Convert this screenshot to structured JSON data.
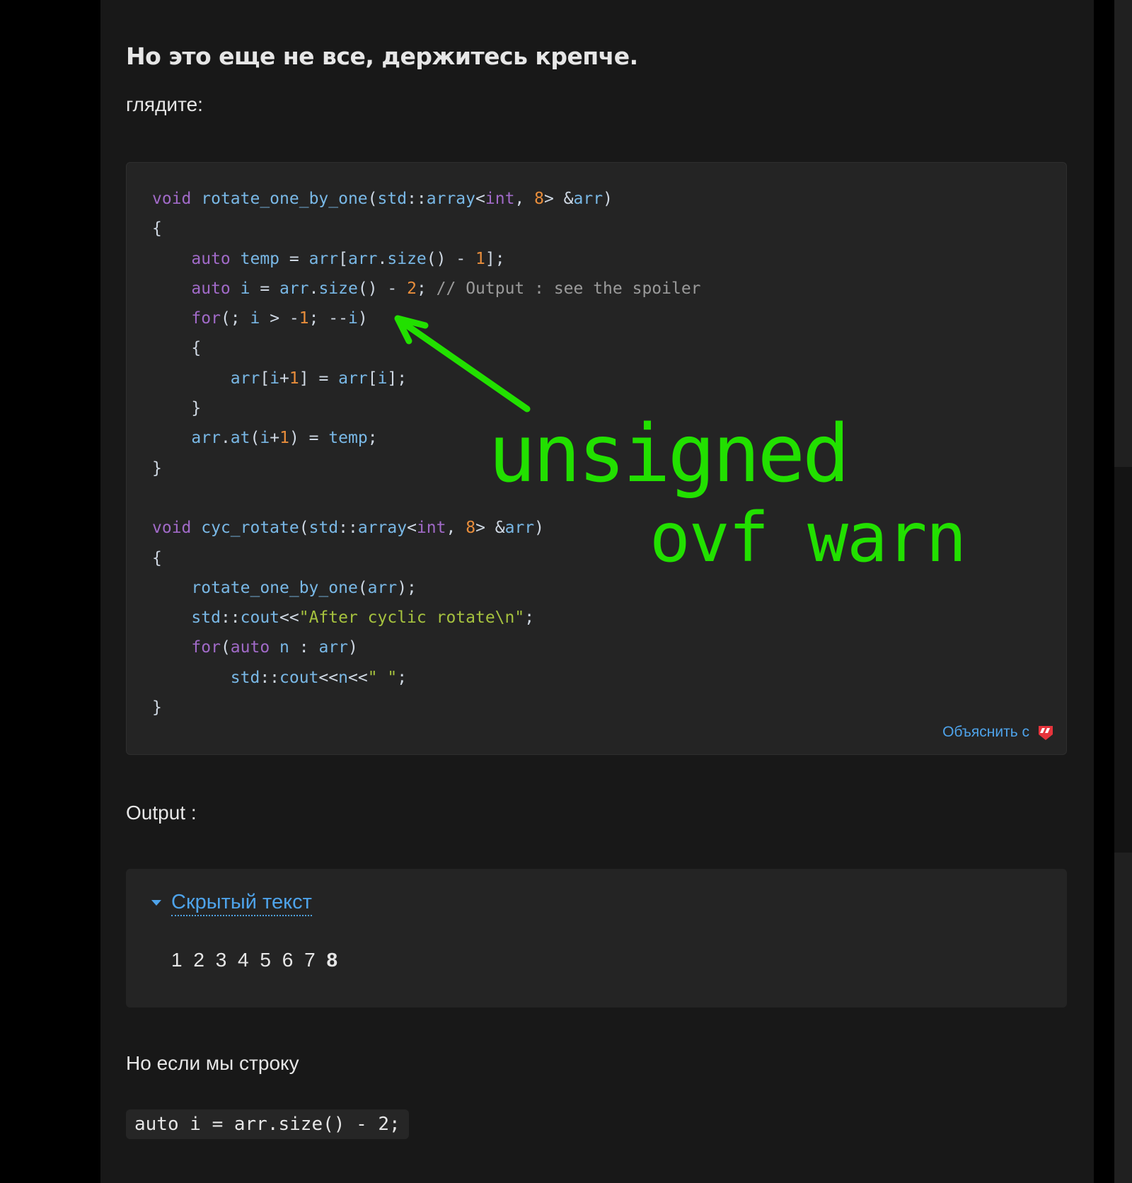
{
  "article": {
    "heading": "Но это еще не все, держитесь крепче.",
    "intro": "глядите:",
    "output_label": "Output :",
    "next_para": "Но если мы строку",
    "inline_code": "auto i = arr.size() - 2;"
  },
  "code_block": {
    "lines": [
      [
        {
          "t": "void",
          "c": "kw"
        },
        {
          "t": " "
        },
        {
          "t": "rotate_one_by_one",
          "c": "fn"
        },
        {
          "t": "("
        },
        {
          "t": "std",
          "c": "fn"
        },
        {
          "t": "::"
        },
        {
          "t": "array",
          "c": "fn"
        },
        {
          "t": "<"
        },
        {
          "t": "int",
          "c": "kw"
        },
        {
          "t": ", "
        },
        {
          "t": "8",
          "c": "num"
        },
        {
          "t": "> &"
        },
        {
          "t": "arr",
          "c": "fn"
        },
        {
          "t": ")"
        }
      ],
      [
        {
          "t": "{"
        }
      ],
      [
        {
          "t": "    "
        },
        {
          "t": "auto",
          "c": "kw"
        },
        {
          "t": " "
        },
        {
          "t": "temp",
          "c": "fn"
        },
        {
          "t": " = "
        },
        {
          "t": "arr",
          "c": "fn"
        },
        {
          "t": "["
        },
        {
          "t": "arr",
          "c": "fn"
        },
        {
          "t": "."
        },
        {
          "t": "size",
          "c": "fn"
        },
        {
          "t": "() - "
        },
        {
          "t": "1",
          "c": "num"
        },
        {
          "t": "];"
        }
      ],
      [
        {
          "t": "    "
        },
        {
          "t": "auto",
          "c": "kw"
        },
        {
          "t": " "
        },
        {
          "t": "i",
          "c": "fn"
        },
        {
          "t": " = "
        },
        {
          "t": "arr",
          "c": "fn"
        },
        {
          "t": "."
        },
        {
          "t": "size",
          "c": "fn"
        },
        {
          "t": "() - "
        },
        {
          "t": "2",
          "c": "num"
        },
        {
          "t": "; "
        },
        {
          "t": "// Output : see the spoiler",
          "c": "cm"
        }
      ],
      [
        {
          "t": "    "
        },
        {
          "t": "for",
          "c": "kw"
        },
        {
          "t": "(; "
        },
        {
          "t": "i",
          "c": "fn"
        },
        {
          "t": " > -"
        },
        {
          "t": "1",
          "c": "num"
        },
        {
          "t": "; --"
        },
        {
          "t": "i",
          "c": "fn"
        },
        {
          "t": ")"
        }
      ],
      [
        {
          "t": "    {"
        }
      ],
      [
        {
          "t": "        "
        },
        {
          "t": "arr",
          "c": "fn"
        },
        {
          "t": "["
        },
        {
          "t": "i",
          "c": "fn"
        },
        {
          "t": "+"
        },
        {
          "t": "1",
          "c": "num"
        },
        {
          "t": "] = "
        },
        {
          "t": "arr",
          "c": "fn"
        },
        {
          "t": "["
        },
        {
          "t": "i",
          "c": "fn"
        },
        {
          "t": "];"
        }
      ],
      [
        {
          "t": "    }"
        }
      ],
      [
        {
          "t": "    "
        },
        {
          "t": "arr",
          "c": "fn"
        },
        {
          "t": "."
        },
        {
          "t": "at",
          "c": "fn"
        },
        {
          "t": "("
        },
        {
          "t": "i",
          "c": "fn"
        },
        {
          "t": "+"
        },
        {
          "t": "1",
          "c": "num"
        },
        {
          "t": ") = "
        },
        {
          "t": "temp",
          "c": "fn"
        },
        {
          "t": ";"
        }
      ],
      [
        {
          "t": "}"
        }
      ],
      [
        {
          "t": ""
        }
      ],
      [
        {
          "t": "void",
          "c": "kw"
        },
        {
          "t": " "
        },
        {
          "t": "cyc_rotate",
          "c": "fn"
        },
        {
          "t": "("
        },
        {
          "t": "std",
          "c": "fn"
        },
        {
          "t": "::"
        },
        {
          "t": "array",
          "c": "fn"
        },
        {
          "t": "<"
        },
        {
          "t": "int",
          "c": "kw"
        },
        {
          "t": ", "
        },
        {
          "t": "8",
          "c": "num"
        },
        {
          "t": "> &"
        },
        {
          "t": "arr",
          "c": "fn"
        },
        {
          "t": ")"
        }
      ],
      [
        {
          "t": "{"
        }
      ],
      [
        {
          "t": "    "
        },
        {
          "t": "rotate_one_by_one",
          "c": "fn"
        },
        {
          "t": "("
        },
        {
          "t": "arr",
          "c": "fn"
        },
        {
          "t": ");"
        }
      ],
      [
        {
          "t": "    "
        },
        {
          "t": "std",
          "c": "fn"
        },
        {
          "t": "::"
        },
        {
          "t": "cout",
          "c": "fn"
        },
        {
          "t": "<<"
        },
        {
          "t": "\"After cyclic rotate\\n\"",
          "c": "str"
        },
        {
          "t": ";"
        }
      ],
      [
        {
          "t": "    "
        },
        {
          "t": "for",
          "c": "kw"
        },
        {
          "t": "("
        },
        {
          "t": "auto",
          "c": "kw"
        },
        {
          "t": " "
        },
        {
          "t": "n",
          "c": "fn"
        },
        {
          "t": " : "
        },
        {
          "t": "arr",
          "c": "fn"
        },
        {
          "t": ")"
        }
      ],
      [
        {
          "t": "        "
        },
        {
          "t": "std",
          "c": "fn"
        },
        {
          "t": "::"
        },
        {
          "t": "cout",
          "c": "fn"
        },
        {
          "t": "<<"
        },
        {
          "t": "n",
          "c": "fn"
        },
        {
          "t": "<<"
        },
        {
          "t": "\" \"",
          "c": "str"
        },
        {
          "t": ";"
        }
      ],
      [
        {
          "t": "}"
        }
      ]
    ],
    "explain_label": "Объяснить с"
  },
  "spoiler": {
    "label": "Скрытый текст",
    "content_plain": "1 2 3 4 5 6 7 ",
    "content_bold": "8"
  },
  "annotation": {
    "line1": "unsigned",
    "line2": "ovf warn",
    "color": "#22e000"
  },
  "colors": {
    "keyword": "#a16ac8",
    "identifier": "#79b8e6",
    "number": "#e88d3b",
    "string": "#a6c23e",
    "comment": "#9a9a9a",
    "link": "#4ea3ea"
  }
}
